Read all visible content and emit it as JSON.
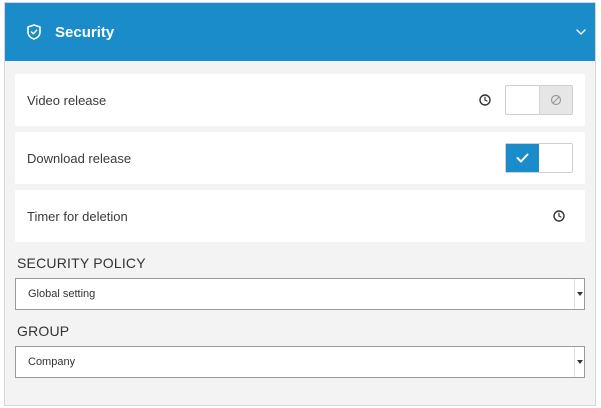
{
  "panel": {
    "title": "Security",
    "header_icon": "shield-icon",
    "collapse_icon": "chevron-down-icon"
  },
  "settings": [
    {
      "label": "Video release",
      "clock_icon": "clock-icon",
      "toggle": "off"
    },
    {
      "label": "Download release",
      "toggle": "on"
    },
    {
      "label": "Timer for deletion",
      "clock_icon": "clock-icon"
    }
  ],
  "security_policy": {
    "label": "SECURITY POLICY",
    "value": "Global setting"
  },
  "group": {
    "label": "GROUP",
    "value": "Company"
  },
  "colors": {
    "accent": "#1a8cc9",
    "panel_bg": "#f3f3f3",
    "row_bg": "#ffffff"
  }
}
